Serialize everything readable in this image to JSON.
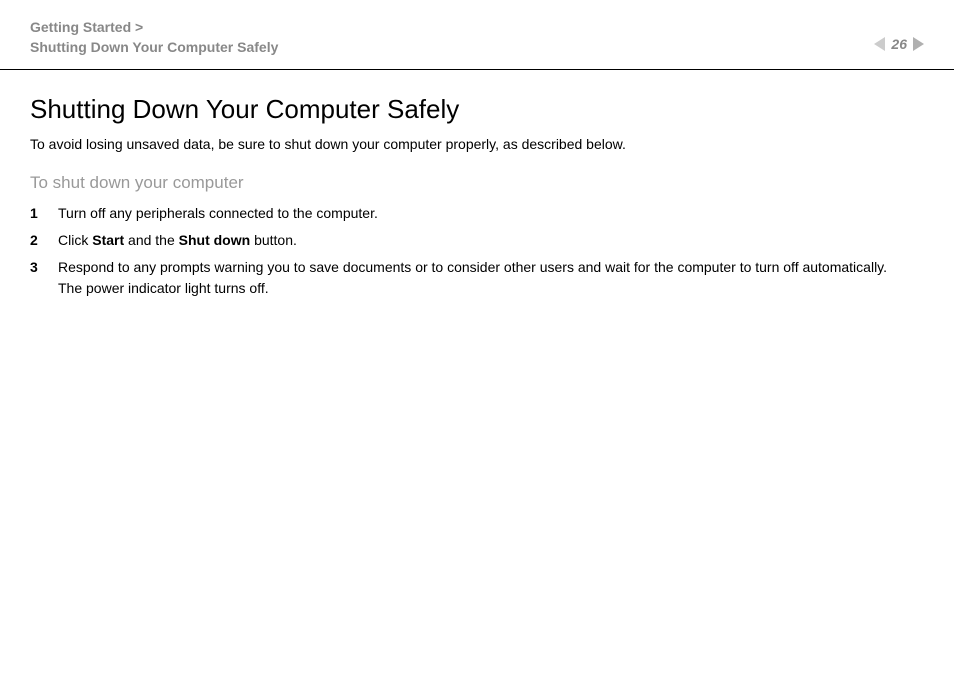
{
  "breadcrumb": {
    "line1": "Getting Started >",
    "line2": "Shutting Down Your Computer Safely"
  },
  "page_number": "26",
  "content": {
    "title": "Shutting Down Your Computer Safely",
    "intro": "To avoid losing unsaved data, be sure to shut down your computer properly, as described below.",
    "section_heading": "To shut down your computer",
    "steps": [
      {
        "num": "1",
        "text_before": "Turn off any peripherals connected to the computer.",
        "bold1": "",
        "text_mid": "",
        "bold2": "",
        "text_after": ""
      },
      {
        "num": "2",
        "text_before": "Click ",
        "bold1": "Start",
        "text_mid": " and the ",
        "bold2": "Shut down",
        "text_after": " button."
      },
      {
        "num": "3",
        "text_before": "Respond to any prompts warning you to save documents or to consider other users and wait for the computer to turn off automatically.",
        "bold1": "",
        "text_mid": "",
        "bold2": "",
        "text_after": "",
        "line2": "The power indicator light turns off."
      }
    ]
  }
}
